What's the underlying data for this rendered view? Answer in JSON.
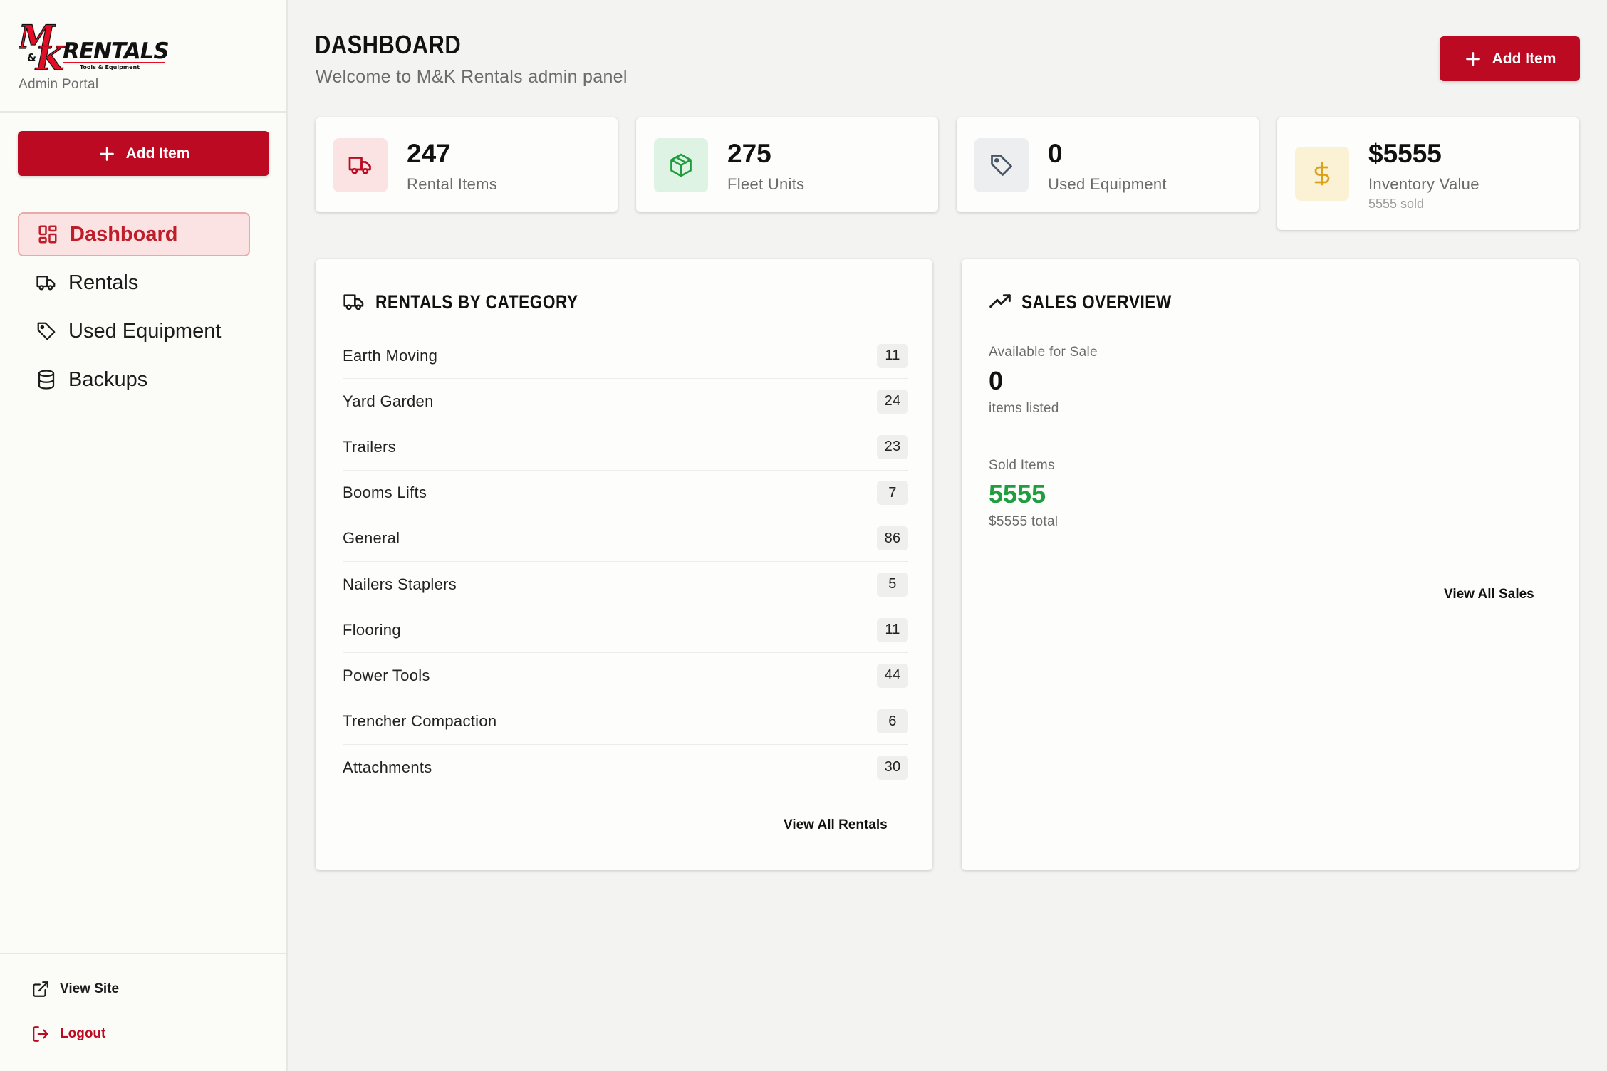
{
  "brand": {
    "logo_text": "M&K RENTALS",
    "logo_tagline": "Tools & Equipment",
    "subtitle": "Admin Portal",
    "colors": {
      "primary": "#bd0a23",
      "logo_red": "#e30d25",
      "logo_black": "#111111"
    }
  },
  "sidebar": {
    "add_label": "Add Item",
    "nav": [
      {
        "label": "Dashboard",
        "icon": "dashboard-grid-icon",
        "active": true
      },
      {
        "label": "Rentals",
        "icon": "truck-icon",
        "active": false
      },
      {
        "label": "Used Equipment",
        "icon": "tag-icon",
        "active": false
      },
      {
        "label": "Backups",
        "icon": "database-icon",
        "active": false
      }
    ],
    "footer": {
      "view_site": "View Site",
      "logout": "Logout"
    }
  },
  "header": {
    "title": "DASHBOARD",
    "subtitle": "Welcome to M&K Rentals admin panel",
    "add_label": "Add Item"
  },
  "stats": [
    {
      "value": "247",
      "label": "Rental Items",
      "icon": "truck-icon",
      "color": "#bd0a23",
      "bg": "#fbe3e3"
    },
    {
      "value": "275",
      "label": "Fleet Units",
      "icon": "box-icon",
      "color": "#1f9e3f",
      "bg": "#dff3e4"
    },
    {
      "value": "0",
      "label": "Used Equipment",
      "icon": "tag-icon",
      "color": "#4a5563",
      "bg": "#eceef0"
    },
    {
      "value": "$5555",
      "label": "Inventory Value",
      "extra": "5555 sold",
      "icon": "dollar-icon",
      "color": "#d9a21a",
      "bg": "#fbf2d6"
    }
  ],
  "rentals_panel": {
    "title": "RENTALS BY CATEGORY",
    "categories": [
      {
        "name": "Earth Moving",
        "count": "11"
      },
      {
        "name": "Yard Garden",
        "count": "24"
      },
      {
        "name": "Trailers",
        "count": "23"
      },
      {
        "name": "Booms Lifts",
        "count": "7"
      },
      {
        "name": "General",
        "count": "86"
      },
      {
        "name": "Nailers Staplers",
        "count": "5"
      },
      {
        "name": "Flooring",
        "count": "11"
      },
      {
        "name": "Power Tools",
        "count": "44"
      },
      {
        "name": "Trencher Compaction",
        "count": "6"
      },
      {
        "name": "Attachments",
        "count": "30"
      }
    ],
    "link": "View All Rentals"
  },
  "sales_panel": {
    "title": "SALES OVERVIEW",
    "available_label": "Available for Sale",
    "available_value": "0",
    "available_caption": "items listed",
    "sold_label": "Sold Items",
    "sold_value": "5555",
    "sold_caption": "$5555 total",
    "sold_color": "#1f9e3f",
    "link": "View All Sales"
  }
}
